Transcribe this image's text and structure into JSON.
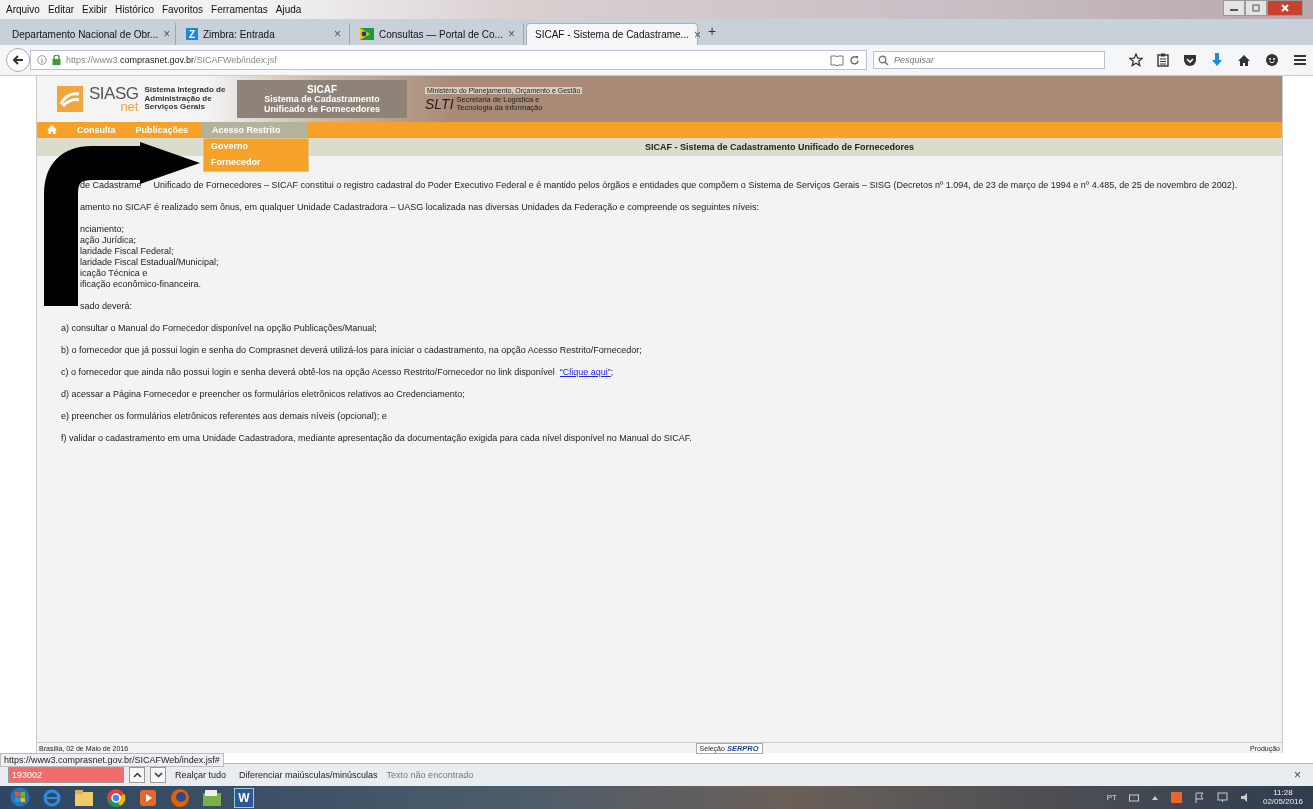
{
  "menubar": [
    "Arquivo",
    "Editar",
    "Exibir",
    "Histórico",
    "Favoritos",
    "Ferramentas",
    "Ajuda"
  ],
  "tabs": [
    {
      "label": "Departamento Nacional de Obr...",
      "kind": "plain",
      "selected": false
    },
    {
      "label": "Zimbra: Entrada",
      "kind": "letter",
      "icon_text": "Z",
      "selected": false
    },
    {
      "label": "Consultas — Portal de Co...",
      "kind": "flag",
      "selected": false
    },
    {
      "label": "SICAF - Sistema de Cadastrame...",
      "kind": "plain",
      "selected": true
    }
  ],
  "tab_close": "×",
  "new_tab": "+",
  "address": {
    "prefix": "https://www3.",
    "domain": "comprasnet.gov.br",
    "suffix": "/SICAFWeb/index.jsf"
  },
  "search": {
    "placeholder": "Pesquisar"
  },
  "header": {
    "logo": "SIASG",
    "logo_sub": "net",
    "system_name": "Sistema Integrado de\nAdministração de\nServiços Gerais",
    "sicaf": "SICAF",
    "sicaf_name": "Sistema de Cadastramento\nUnificado de Fornecedores",
    "ministry": "Ministério do Planejamento, Orçamento e Gestão",
    "slti": "SLTI",
    "slti_name": "Secretaria de Logística e\nTecnologia da Informação"
  },
  "site_menu": [
    {
      "label": "Consulta",
      "selected": false
    },
    {
      "label": "Publicações",
      "selected": false
    },
    {
      "label": "Acesso Restrito",
      "selected": true
    }
  ],
  "dropdown": [
    "Governo",
    "Fornecedor"
  ],
  "page_title": "SICAF - Sistema de Cadastramento Unificado de Fornecedores",
  "intro": [
    "de Cadastrame",
    "Unificado de Fornecedores – SICAF constitui o registro cadastral do Poder Executivo Federal e é mantido pelos órgãos e entidades que compõem o Sistema de Serviços Gerais – SISG (Decretos nº 1.094, de 23 de março de 1994 e nº 4.485, de 25 de novembro de 2002)."
  ],
  "scope": "amento no SICAF é realizado sem ônus, em qualquer Unidade Cadastradora – UASG localizada nas diversas Unidades da Federação e compreende os seguintes níveis:",
  "levels": [
    "nciamento;",
    "ação Jurídica;",
    "laridade Fiscal Federal;",
    "laridade Fiscal Estadual/Municipal;",
    "icação Técnica e",
    "ificação econômico-financeira."
  ],
  "steps_intro": "sado deverá:",
  "steps": [
    {
      "text": "a) consultar o Manual do Fornecedor disponível na opção Publicações/Manual;"
    },
    {
      "text": "b) o fornecedor que já possui login e senha do Comprasnet deverá utilizá-los para iniciar o cadastramento, na opção Acesso Restrito/Fornecedor;"
    },
    {
      "text": "c) o fornecedor que ainda não possui login e senha deverá obtê-los na opção Acesso Restrito/Fornecedor no link disponível",
      "link": "“Clique aqui”",
      "after": ";"
    },
    {
      "text": "d) acessar a Página Fornecedor e preencher os formulários eletrônicos relativos ao Credenciamento;"
    },
    {
      "text": "e) preencher os formulários eletrônicos referentes aos demais níveis (opcional); e"
    },
    {
      "text": "f) validar o cadastramento em uma Unidade Cadastradora, mediante apresentação da documentação exigida para cada nível disponível no Manual do SICAF."
    }
  ],
  "footer": {
    "date": "Brasília, 02 de Maio de 2016",
    "badge_small": "Seleção",
    "badge": "SERPRO",
    "environment": "Produção"
  },
  "status_url": "https://www3.comprasnet.gov.br/SICAFWeb/index.jsf#",
  "findbar": {
    "value": "193002",
    "not_found": true,
    "highlight_all": "Realçar tudo",
    "match_case": "Diferenciar maiúsculas/minúsculas",
    "status": "Texto não encontrado",
    "close": "×"
  },
  "taskbar": {
    "word_letter": "W",
    "language": "PT",
    "time": "11:28",
    "date": "02/05/2016"
  }
}
